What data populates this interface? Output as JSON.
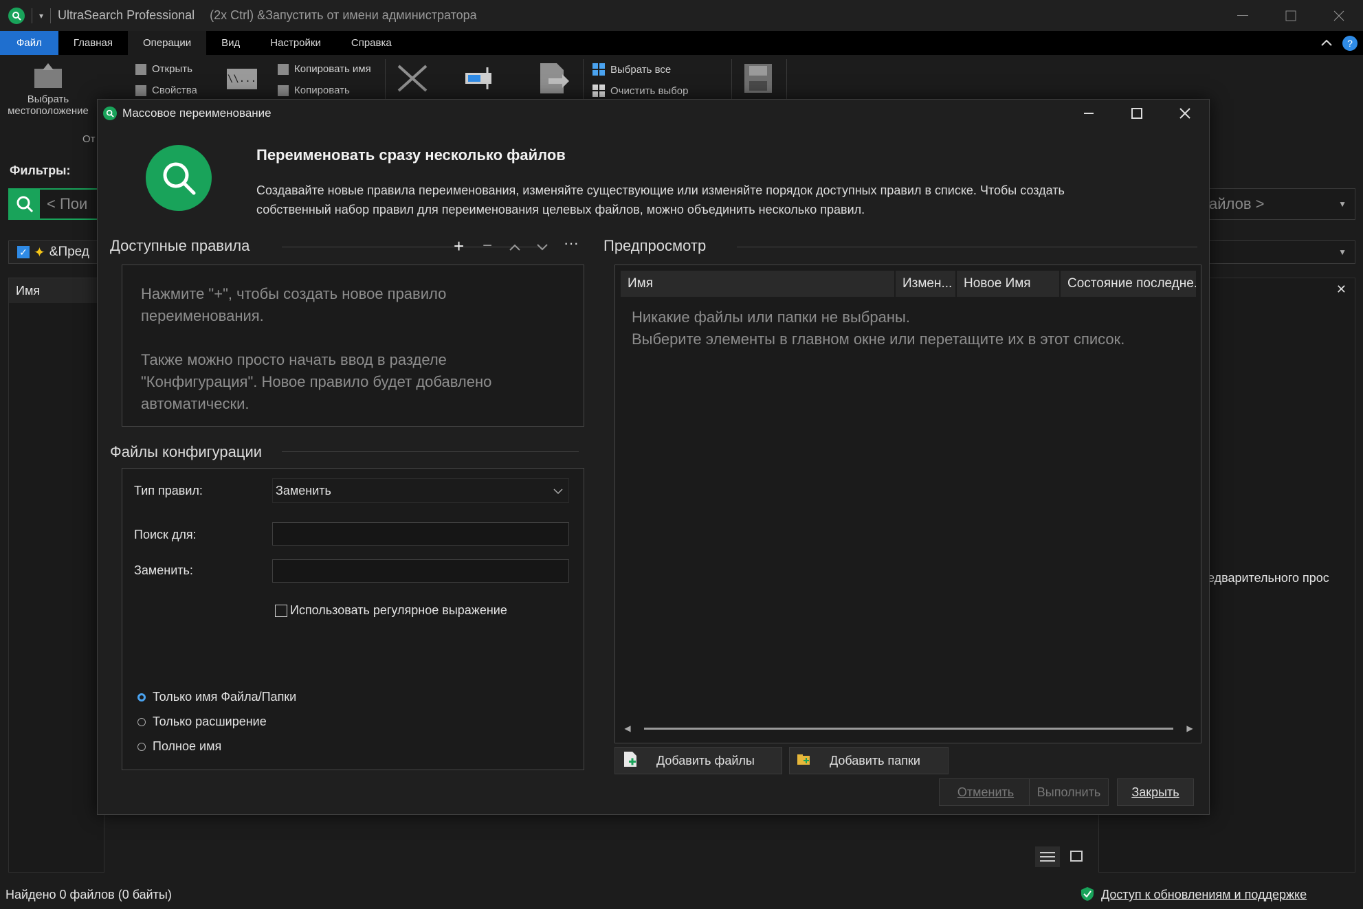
{
  "window": {
    "title": "UltraSearch Professional",
    "subtitle": "(2x Ctrl) &Запустить от имени администратора"
  },
  "menu": [
    "Файл",
    "Главная",
    "Операции",
    "Вид",
    "Настройки",
    "Справка"
  ],
  "ribbon": {
    "select_location_line1": "Выбрать",
    "select_location_line2": "местоположение",
    "open": "Открыть",
    "properties": "Свойства",
    "copy_name": "Копировать имя",
    "copy": "Копировать",
    "select_all": "Выбрать все",
    "clear_selection": "Очистить выбор",
    "group_label_partial": "От"
  },
  "main": {
    "filters_label": "Фильтры:",
    "search_placeholder": "< Пои",
    "preset_label": "&Пред",
    "column_name": "Имя",
    "right_dropdown_text": "айлов >",
    "preview_partial": "едварительного прос"
  },
  "dialog": {
    "title": "Массовое переименование",
    "heading": "Переименовать сразу несколько файлов",
    "description_line1": "Создавайте новые правила переименования, изменяйте существующие или изменяйте порядок доступных правил в списке. Чтобы создать",
    "description_line2": "собственный набор правил для переименования целевых файлов, можно объединить несколько правил.",
    "available_rules": {
      "title": "Доступные правила",
      "hint_line1": "Нажмите \"+\", чтобы создать новое правило",
      "hint_line2": "переименования.",
      "hint_line3": "Также можно просто начать ввод в разделе",
      "hint_line4": "\"Конфигурация\". Новое правило будет добавлено",
      "hint_line5": "автоматически."
    },
    "config": {
      "title": "Файлы конфигурации",
      "rule_type_label": "Тип правил:",
      "rule_type_value": "Заменить",
      "search_label": "Поиск для:",
      "search_value": "",
      "replace_label": "Заменить:",
      "replace_value": "",
      "regex_label": "Использовать регулярное выражение",
      "regex_checked": false,
      "scope_options": [
        "Только имя Файла/Папки",
        "Только расширение",
        "Полное имя"
      ],
      "scope_selected": 0
    },
    "preview": {
      "title": "Предпросмотр",
      "columns": [
        "Имя",
        "Измен...",
        "Новое Имя",
        "Состояние последне."
      ],
      "empty_line1": "Никакие файлы или папки не выбраны.",
      "empty_line2": "Выберите элементы в главном окне или перетащите их в этот список."
    },
    "buttons": {
      "add_files": "Добавить файлы",
      "add_folders": "Добавить папки",
      "cancel": "Отменить",
      "execute": "Выполнить",
      "close": "Закрыть"
    }
  },
  "status": {
    "found": "Найдено 0 файлов (0 байты)",
    "updates_link": "Доступ к обновлениям и поддержке"
  },
  "colors": {
    "accent_green": "#19a35a",
    "file_menu_blue": "#1f6fcf",
    "checkbox_blue": "#2f8be6"
  }
}
